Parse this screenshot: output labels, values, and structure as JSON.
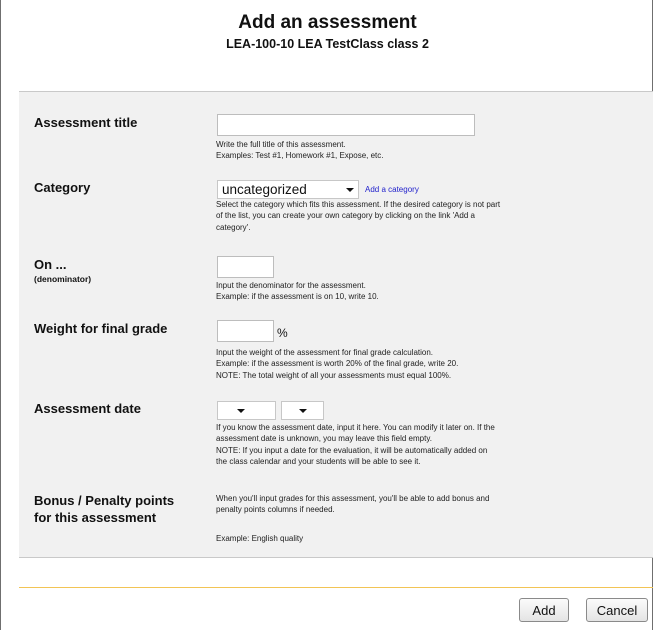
{
  "header": {
    "title": "Add an assessment",
    "subtitle": "LEA-100-10 LEA TestClass class 2"
  },
  "form": {
    "assessment_title": {
      "label": "Assessment title",
      "value": "",
      "help": [
        "Write the full title of this assessment.",
        "Examples: Test #1, Homework #1, Expose, etc."
      ]
    },
    "category": {
      "label": "Category",
      "selected": "uncategorized",
      "add_link": "Add a category",
      "help": [
        "Select the category which fits this assessment. If the desired category is not part",
        "of the list, you can create your own category by clicking on the link 'Add a",
        "category'."
      ]
    },
    "on": {
      "label": "On ...",
      "sublabel": "(denominator)",
      "value": "",
      "help": [
        "Input the denominator for the assessment.",
        "Example: if the assessment is on 10, write 10."
      ]
    },
    "weight": {
      "label": "Weight for final grade",
      "value": "",
      "unit": "%",
      "help": [
        "Input the weight of the assessment for final grade calculation.",
        "Example: if the assessment is worth 20% of the final grade, write 20.",
        "NOTE: The total weight of all your assessments must equal 100%."
      ]
    },
    "date": {
      "label": "Assessment date",
      "first_value": "",
      "second_value": "",
      "help": [
        "If you know the assessment date, input it here. You can modify it later on. If the",
        "assessment date is unknown, you may leave this field empty.",
        "NOTE: If you input a date for the evaluation, it will be automatically added on",
        "the class calendar and your students will be able to see it."
      ]
    },
    "bonus": {
      "label_line1": "Bonus / Penalty points",
      "label_line2": "for this assessment",
      "help": [
        "When you'll input grades for this assessment, you'll be able to add bonus and",
        "penalty points columns if needed."
      ],
      "example": "Example: English quality"
    }
  },
  "buttons": {
    "add": "Add",
    "cancel": "Cancel"
  },
  "colors": {
    "panel_bg": "#f1f1f1",
    "link": "#2222cc",
    "divider": "#f2c455"
  }
}
